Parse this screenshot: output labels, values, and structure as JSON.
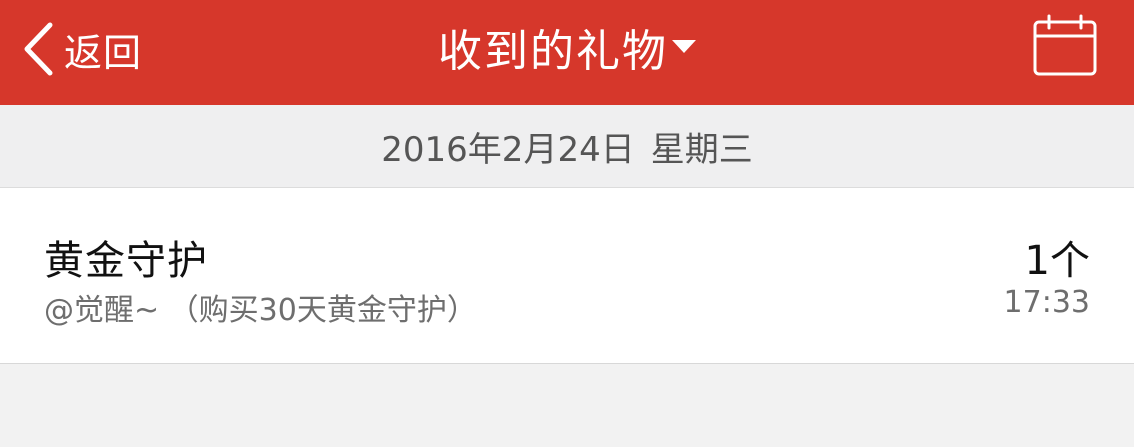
{
  "navbar": {
    "back_label": "返回",
    "title": "收到的礼物",
    "calendar_icon": "calendar-icon",
    "back_icon": "chevron-left-icon",
    "dropdown_icon": "caret-down-icon",
    "bar_color": "#d6372b"
  },
  "date_header": {
    "date": "2016年2月24日",
    "weekday": "星期三"
  },
  "gifts": [
    {
      "name": "黄金守护",
      "sender": "@觉醒~ （购买30天黄金守护）",
      "count": "1个",
      "time": "17:33"
    }
  ]
}
